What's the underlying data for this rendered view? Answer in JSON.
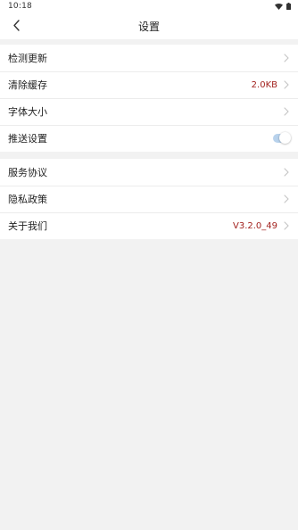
{
  "status_bar": {
    "time": "10:18"
  },
  "header": {
    "title": "设置"
  },
  "groups": [
    {
      "items": [
        {
          "label": "检测更新",
          "value": ""
        },
        {
          "label": "清除缓存",
          "value": "2.0KB"
        },
        {
          "label": "字体大小",
          "value": ""
        },
        {
          "label": "推送设置",
          "value": "",
          "toggle_on": true
        }
      ]
    },
    {
      "items": [
        {
          "label": "服务协议",
          "value": ""
        },
        {
          "label": "隐私政策",
          "value": ""
        },
        {
          "label": "关于我们",
          "value": "V3.2.0_49"
        }
      ]
    }
  ],
  "colors": {
    "accent_value": "#a3231f",
    "toggle_track": "#b8d2ec",
    "background": "#f2f2f2"
  }
}
